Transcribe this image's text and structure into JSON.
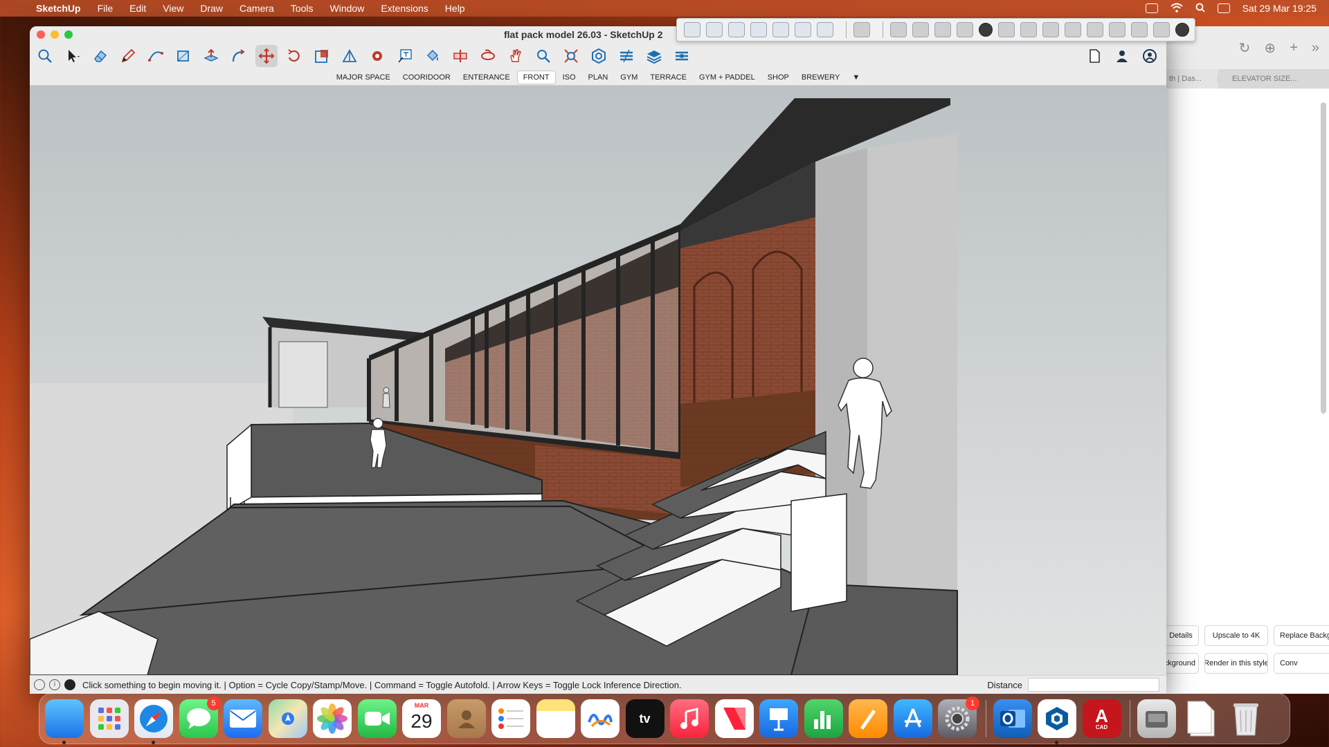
{
  "menubar": {
    "app_name": "SketchUp",
    "items": [
      "File",
      "Edit",
      "View",
      "Draw",
      "Camera",
      "Tools",
      "Window",
      "Extensions",
      "Help"
    ],
    "clock": "Sat 29 Mar  19:25"
  },
  "window": {
    "title": "flat pack model 26.03 - SketchUp 2"
  },
  "toolbar": {
    "tools": [
      "search-icon",
      "select-icon",
      "eraser-icon",
      "pencil-icon",
      "arc-icon",
      "rectangle-icon",
      "push-pull-icon",
      "follow-me-icon",
      "move-icon",
      "rotate-icon",
      "scale-icon",
      "protractor-icon",
      "dimension-icon",
      "text-icon",
      "paint-bucket-icon",
      "section-plane-icon",
      "orbit-icon",
      "pan-icon",
      "zoom-icon",
      "zoom-extents-icon",
      "components-icon",
      "tags-icon",
      "layers-icon",
      "styles-icon"
    ],
    "active_tool": "move-icon"
  },
  "scenes": {
    "tabs": [
      "MAJOR SPACE",
      "COORIDOOR",
      "ENTERANCE",
      "FRONT",
      "ISO",
      "PLAN",
      "GYM",
      "TERRACE",
      "GYM + PADDEL",
      "SHOP",
      "BREWERY"
    ],
    "active": "FRONT",
    "more": "▼"
  },
  "status": {
    "message": "Click something to begin moving it. | Option = Cycle Copy/Stamp/Move. | Command = Toggle Autofold. | Arrow Keys = Toggle Lock Inference Direction.",
    "measure_label": "Distance",
    "measure_value": ""
  },
  "browser": {
    "tab1": "th | Das...",
    "tab2": "ELEVATOR SIZE...",
    "buttons": [
      "Details",
      "Upscale to 4K",
      "Replace Backgrou",
      "ckground",
      "Render in this style",
      "Conv"
    ]
  },
  "dock": {
    "messages_badge": "5",
    "calendar_month": "MAR",
    "calendar_day": "29",
    "settings_badge": "1",
    "autocad_label": "A",
    "autocad_sub": "CAD"
  },
  "colors": {
    "sky_top": "#bfc4c7",
    "sky_bottom": "#dfe1e2",
    "brick": "#8b4a35",
    "timber": "#6e3b22",
    "floor": "#5d5d5d",
    "frame": "#2c2c2c"
  }
}
